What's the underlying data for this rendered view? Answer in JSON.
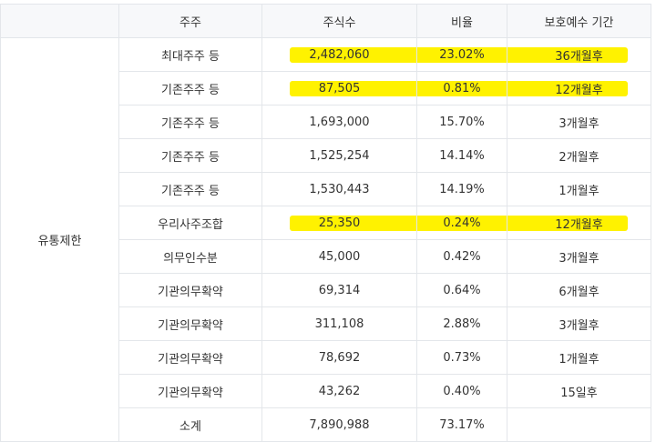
{
  "table": {
    "headers": [
      "주주",
      "주식수",
      "비율",
      "보호예수 기간"
    ],
    "group_label": "유통제한",
    "rows": [
      {
        "holder": "최대주주 등",
        "shares": "2,482,060",
        "ratio": "23.02%",
        "period": "36개월후",
        "highlight": true
      },
      {
        "holder": "기존주주 등",
        "shares": "87,505",
        "ratio": "0.81%",
        "period": "12개월후",
        "highlight": true
      },
      {
        "holder": "기존주주 등",
        "shares": "1,693,000",
        "ratio": "15.70%",
        "period": "3개월후",
        "highlight": false
      },
      {
        "holder": "기존주주 등",
        "shares": "1,525,254",
        "ratio": "14.14%",
        "period": "2개월후",
        "highlight": false
      },
      {
        "holder": "기존주주 등",
        "shares": "1,530,443",
        "ratio": "14.19%",
        "period": "1개월후",
        "highlight": false
      },
      {
        "holder": "우리사주조합",
        "shares": "25,350",
        "ratio": "0.24%",
        "period": "12개월후",
        "highlight": true
      },
      {
        "holder": "의무인수분",
        "shares": "45,000",
        "ratio": "0.42%",
        "period": "3개월후",
        "highlight": false
      },
      {
        "holder": "기관의무확약",
        "shares": "69,314",
        "ratio": "0.64%",
        "period": "6개월후",
        "highlight": false
      },
      {
        "holder": "기관의무확약",
        "shares": "311,108",
        "ratio": "2.88%",
        "period": "3개월후",
        "highlight": false
      },
      {
        "holder": "기관의무확약",
        "shares": "78,692",
        "ratio": "0.73%",
        "period": "1개월후",
        "highlight": false
      },
      {
        "holder": "기관의무확약",
        "shares": "43,262",
        "ratio": "0.40%",
        "period": "15일후",
        "highlight": false
      },
      {
        "holder": "소계",
        "shares": "7,890,988",
        "ratio": "73.17%",
        "period": "",
        "highlight": false
      }
    ]
  },
  "colors": {
    "highlight": "#fff200",
    "border": "#e3e6ea",
    "header_bg": "#f7f8fa",
    "text": "#333333"
  }
}
